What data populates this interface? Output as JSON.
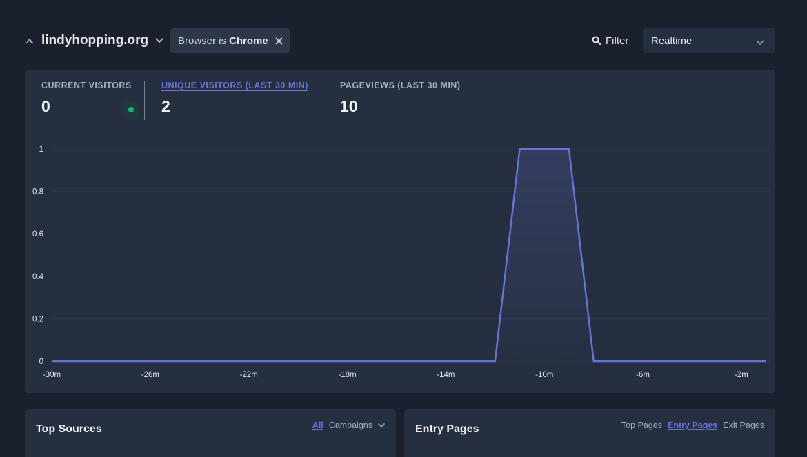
{
  "header": {
    "site_name": "lindyhopping.org",
    "filter_pill": {
      "prefix": "Browser is",
      "value": "Chrome"
    },
    "filter_button": "Filter",
    "period": "Realtime"
  },
  "stats": [
    {
      "label": "CURRENT VISITORS",
      "value": "0"
    },
    {
      "label": "UNIQUE VISITORS (LAST 30 MIN)",
      "value": "2"
    },
    {
      "label": "PAGEVIEWS (LAST 30 MIN)",
      "value": "10"
    }
  ],
  "chart_data": {
    "type": "area",
    "title": "",
    "xlabel": "",
    "ylabel": "",
    "x_minutes": [
      -30,
      -29,
      -28,
      -27,
      -26,
      -25,
      -24,
      -23,
      -22,
      -21,
      -20,
      -19,
      -18,
      -17,
      -16,
      -15,
      -14,
      -13,
      -12,
      -11,
      -10,
      -9,
      -8,
      -7,
      -6,
      -5,
      -4,
      -3,
      -2,
      -1
    ],
    "x_tick_labels": [
      "-30m",
      "-26m",
      "-22m",
      "-18m",
      "-14m",
      "-10m",
      "-6m",
      "-2m"
    ],
    "x_tick_values": [
      -30,
      -26,
      -22,
      -18,
      -14,
      -10,
      -6,
      -2
    ],
    "y_ticks": [
      "1",
      "0.8",
      "0.6",
      "0.4",
      "0.2",
      "0"
    ],
    "y_tick_values": [
      1,
      0.8,
      0.6,
      0.4,
      0.2,
      0
    ],
    "ylim": [
      0,
      1
    ],
    "values": [
      0,
      0,
      0,
      0,
      0,
      0,
      0,
      0,
      0,
      0,
      0,
      0,
      0,
      0,
      0,
      0,
      0,
      0,
      0,
      1,
      1,
      1,
      0,
      0,
      0,
      0,
      0,
      0,
      0,
      0
    ],
    "color": "#6674d6",
    "grid": true
  },
  "panels": {
    "sources": {
      "title": "Top Sources",
      "tabs": [
        "All",
        "Campaigns"
      ]
    },
    "pages": {
      "title": "Entry Pages",
      "tabs": [
        "Top Pages",
        "Entry Pages",
        "Exit Pages"
      ]
    }
  },
  "colors": {
    "background": "#1a202c",
    "card": "#252f3f",
    "accent": "#6674d6",
    "live": "#10b981"
  }
}
